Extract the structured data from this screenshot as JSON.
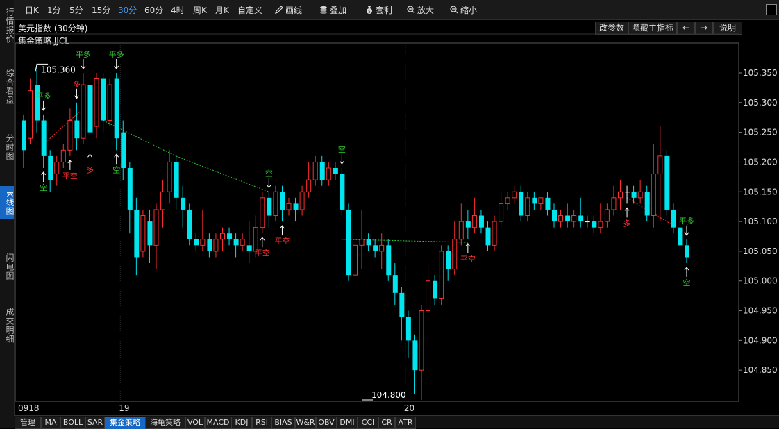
{
  "sidebar": {
    "tabs": [
      {
        "label": "行情报价",
        "active": false
      },
      {
        "label": "综合看盘",
        "active": false
      },
      {
        "label": "分时图",
        "active": false
      },
      {
        "label": "K线图",
        "active": true
      },
      {
        "label": "闪电图",
        "active": false
      },
      {
        "label": "成交明细",
        "active": false
      }
    ]
  },
  "toolbar": {
    "periods": [
      "日K",
      "1分",
      "5分",
      "15分",
      "30分",
      "60分",
      "4时",
      "周K",
      "月K",
      "自定义"
    ],
    "active_period": "30分",
    "draw_label": "画线",
    "overlay_label": "叠加",
    "arbitrage_label": "套利",
    "zoom_in_label": "放大",
    "zoom_out_label": "缩小"
  },
  "chart_header": {
    "title": "美元指数 (30分钟)",
    "strategy": "集金策略 JJCL",
    "buttons": [
      "改参数",
      "隐藏主指标",
      "←",
      "→",
      "说明"
    ]
  },
  "bottom_tabs": {
    "items": [
      "管理",
      "MA",
      "BOLL",
      "SAR",
      "集金策略",
      "海龟策略",
      "VOL",
      "MACD",
      "KDJ",
      "RSI",
      "BIAS",
      "W&R",
      "OBV",
      "DMI",
      "CCI",
      "CR",
      "ATR"
    ],
    "active": "集金策略"
  },
  "colors": {
    "up": "#ff3030",
    "down": "#00e5ee",
    "buy": "#ff3030",
    "sell": "#32cd32",
    "doji": "#ffffff"
  },
  "chart_data": {
    "type": "candlestick",
    "title": "美元指数 (30分钟)",
    "y_ticks": [
      105.35,
      105.3,
      105.25,
      105.2,
      105.15,
      105.1,
      105.05,
      105.0,
      104.95,
      104.9,
      104.85
    ],
    "ylim": [
      104.8,
      105.385
    ],
    "x_labels": [
      {
        "index": 0,
        "text": "0918"
      },
      {
        "index": 15,
        "text": "19"
      },
      {
        "index": 58,
        "text": "20"
      }
    ],
    "max_marker": {
      "index": 2,
      "value": 105.36,
      "label": "105.360"
    },
    "min_marker": {
      "index": 51,
      "value": 104.8,
      "label": "104.800"
    },
    "candles": [
      [
        105.27,
        105.22,
        105.28,
        105.19
      ],
      [
        105.24,
        105.32,
        105.34,
        105.23
      ],
      [
        105.33,
        105.27,
        105.36,
        105.25
      ],
      [
        105.27,
        105.21,
        105.28,
        105.19
      ],
      [
        105.21,
        105.17,
        105.22,
        105.15
      ],
      [
        105.18,
        105.2,
        105.21,
        105.16
      ],
      [
        105.2,
        105.22,
        105.23,
        105.19
      ],
      [
        105.22,
        105.27,
        105.29,
        105.21
      ],
      [
        105.27,
        105.24,
        105.3,
        105.22
      ],
      [
        105.24,
        105.33,
        105.35,
        105.23
      ],
      [
        105.33,
        105.25,
        105.34,
        105.22
      ],
      [
        105.26,
        105.34,
        105.35,
        105.24
      ],
      [
        105.34,
        105.27,
        105.35,
        105.25
      ],
      [
        105.27,
        105.33,
        105.34,
        105.26
      ],
      [
        105.34,
        105.24,
        105.35,
        105.22
      ],
      [
        105.25,
        105.19,
        105.27,
        105.17
      ],
      [
        105.19,
        105.12,
        105.2,
        105.08
      ],
      [
        105.12,
        105.04,
        105.14,
        105.01
      ],
      [
        105.05,
        105.11,
        105.12,
        105.04
      ],
      [
        105.1,
        105.06,
        105.12,
        105.03
      ],
      [
        105.06,
        105.12,
        105.13,
        105.02
      ],
      [
        105.12,
        105.15,
        105.17,
        105.09
      ],
      [
        105.15,
        105.2,
        105.22,
        105.13
      ],
      [
        105.2,
        105.14,
        105.21,
        105.12
      ],
      [
        105.14,
        105.12,
        105.16,
        105.09
      ],
      [
        105.12,
        105.07,
        105.13,
        105.06
      ],
      [
        105.07,
        105.06,
        105.08,
        105.05
      ],
      [
        105.06,
        105.07,
        105.12,
        105.05
      ],
      [
        105.07,
        105.05,
        105.08,
        105.04
      ],
      [
        105.05,
        105.07,
        105.08,
        105.04
      ],
      [
        105.07,
        105.08,
        105.09,
        105.05
      ],
      [
        105.08,
        105.07,
        105.09,
        105.06
      ],
      [
        105.07,
        105.06,
        105.08,
        105.04
      ],
      [
        105.06,
        105.07,
        105.08,
        105.05
      ],
      [
        105.06,
        105.05,
        105.1,
        105.03
      ],
      [
        105.05,
        105.09,
        105.11,
        105.04
      ],
      [
        105.09,
        105.14,
        105.15,
        105.08
      ],
      [
        105.14,
        105.11,
        105.15,
        105.09
      ],
      [
        105.11,
        105.15,
        105.16,
        105.1
      ],
      [
        105.15,
        105.12,
        105.16,
        105.1
      ],
      [
        105.12,
        105.13,
        105.14,
        105.11
      ],
      [
        105.13,
        105.12,
        105.14,
        105.1
      ],
      [
        105.12,
        105.15,
        105.16,
        105.11
      ],
      [
        105.15,
        105.17,
        105.2,
        105.14
      ],
      [
        105.17,
        105.2,
        105.21,
        105.16
      ],
      [
        105.2,
        105.17,
        105.21,
        105.16
      ],
      [
        105.17,
        105.19,
        105.2,
        105.16
      ],
      [
        105.19,
        105.18,
        105.2,
        105.17
      ],
      [
        105.18,
        105.12,
        105.19,
        105.11
      ],
      [
        105.12,
        105.01,
        105.13,
        105.0
      ],
      [
        105.01,
        105.06,
        105.07,
        105.0
      ],
      [
        105.06,
        105.07,
        105.12,
        105.02
      ],
      [
        105.07,
        105.06,
        105.08,
        105.05
      ],
      [
        105.06,
        105.05,
        105.07,
        105.04
      ],
      [
        105.05,
        105.06,
        105.08,
        105.02
      ],
      [
        105.06,
        105.01,
        105.07,
        105.0
      ],
      [
        105.01,
        104.98,
        105.03,
        104.96
      ],
      [
        104.98,
        104.94,
        104.99,
        104.9
      ],
      [
        104.94,
        104.9,
        104.95,
        104.87
      ],
      [
        104.9,
        104.85,
        104.91,
        104.81
      ],
      [
        104.85,
        104.95,
        104.96,
        104.8
      ],
      [
        104.95,
        105.0,
        105.03,
        104.95
      ],
      [
        105.0,
        104.97,
        105.01,
        104.96
      ],
      [
        104.97,
        105.05,
        105.06,
        104.96
      ],
      [
        105.05,
        105.02,
        105.06,
        105.0
      ],
      [
        105.02,
        105.07,
        105.1,
        105.01
      ],
      [
        105.07,
        105.1,
        105.13,
        105.06
      ],
      [
        105.1,
        105.09,
        105.12,
        105.07
      ],
      [
        105.09,
        105.11,
        105.14,
        105.08
      ],
      [
        105.11,
        105.09,
        105.12,
        105.08
      ],
      [
        105.09,
        105.06,
        105.1,
        105.05
      ],
      [
        105.06,
        105.1,
        105.11,
        105.05
      ],
      [
        105.1,
        105.13,
        105.15,
        105.09
      ],
      [
        105.13,
        105.14,
        105.15,
        105.12
      ],
      [
        105.14,
        105.15,
        105.16,
        105.13
      ],
      [
        105.15,
        105.11,
        105.16,
        105.1
      ],
      [
        105.11,
        105.14,
        105.15,
        105.1
      ],
      [
        105.14,
        105.13,
        105.15,
        105.12
      ],
      [
        105.13,
        105.14,
        105.14,
        105.12
      ],
      [
        105.14,
        105.12,
        105.15,
        105.11
      ],
      [
        105.12,
        105.1,
        105.13,
        105.09
      ],
      [
        105.1,
        105.11,
        105.12,
        105.09
      ],
      [
        105.11,
        105.1,
        105.13,
        105.09
      ],
      [
        105.1,
        105.11,
        105.12,
        105.09
      ],
      [
        105.11,
        105.1,
        105.14,
        105.09
      ],
      [
        105.1,
        105.1,
        105.11,
        105.09
      ],
      [
        105.1,
        105.09,
        105.11,
        105.08
      ],
      [
        105.09,
        105.1,
        105.13,
        105.08
      ],
      [
        105.1,
        105.12,
        105.13,
        105.09
      ],
      [
        105.12,
        105.14,
        105.16,
        105.11
      ],
      [
        105.14,
        105.15,
        105.17,
        105.12
      ],
      [
        105.15,
        105.15,
        105.16,
        105.13
      ],
      [
        105.15,
        105.14,
        105.16,
        105.13
      ],
      [
        105.14,
        105.15,
        105.17,
        105.13
      ],
      [
        105.15,
        105.11,
        105.16,
        105.1
      ],
      [
        105.11,
        105.18,
        105.23,
        105.09
      ],
      [
        105.18,
        105.21,
        105.26,
        105.1
      ],
      [
        105.21,
        105.12,
        105.22,
        105.11
      ],
      [
        105.12,
        105.09,
        105.13,
        105.08
      ],
      [
        105.09,
        105.06,
        105.1,
        105.05
      ],
      [
        105.06,
        105.04,
        105.07,
        105.03
      ]
    ],
    "signals": [
      {
        "index": 3,
        "label": "平多",
        "dir": "down",
        "kind": "sell"
      },
      {
        "index": 3,
        "label": "空",
        "dir": "up",
        "kind": "sell"
      },
      {
        "index": 7,
        "label": "平空",
        "dir": "up",
        "kind": "buy"
      },
      {
        "index": 8,
        "label": "多",
        "dir": "down",
        "kind": "buy"
      },
      {
        "index": 9,
        "label": "平多",
        "dir": "down",
        "kind": "sell"
      },
      {
        "index": 10,
        "label": "多",
        "dir": "up",
        "kind": "buy"
      },
      {
        "index": 14,
        "label": "平多",
        "dir": "down",
        "kind": "sell"
      },
      {
        "index": 14,
        "label": "空",
        "dir": "up",
        "kind": "sell"
      },
      {
        "index": 36,
        "label": "平空",
        "dir": "up",
        "kind": "buy"
      },
      {
        "index": 37,
        "label": "空",
        "dir": "down",
        "kind": "sell"
      },
      {
        "index": 39,
        "label": "平空",
        "dir": "up",
        "kind": "buy"
      },
      {
        "index": 48,
        "label": "空",
        "dir": "down",
        "kind": "sell"
      },
      {
        "index": 67,
        "label": "平空",
        "dir": "up",
        "kind": "buy"
      },
      {
        "index": 91,
        "label": "多",
        "dir": "up",
        "kind": "buy"
      },
      {
        "index": 100,
        "label": "平多",
        "dir": "down",
        "kind": "sell"
      },
      {
        "index": 100,
        "label": "空",
        "dir": "up",
        "kind": "sell"
      }
    ],
    "trend_lines": [
      {
        "from": [
          3,
          105.23
        ],
        "to": [
          9,
          105.29
        ],
        "kind": "buy"
      },
      {
        "from": [
          12,
          105.27
        ],
        "to": [
          23,
          105.21
        ],
        "kind": "sell"
      },
      {
        "from": [
          23,
          105.21
        ],
        "to": [
          37,
          105.15
        ],
        "kind": "sell"
      },
      {
        "from": [
          48,
          105.07
        ],
        "to": [
          67,
          105.065
        ],
        "kind": "sell"
      },
      {
        "from": [
          91,
          105.14
        ],
        "to": [
          100,
          105.08
        ],
        "kind": "buy"
      }
    ]
  }
}
